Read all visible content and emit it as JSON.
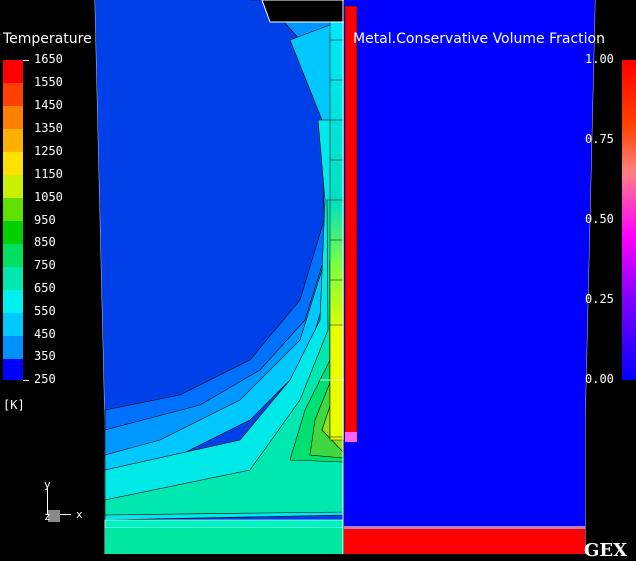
{
  "temperature_legend": {
    "title": "Temperature",
    "unit": "[K]",
    "ticks": [
      "1650",
      "1550",
      "1450",
      "1350",
      "1250",
      "1150",
      "1050",
      "950",
      "850",
      "750",
      "650",
      "550",
      "450",
      "350",
      "250"
    ],
    "colors": [
      "#ff0000",
      "#ff4000",
      "#ff8000",
      "#ffb000",
      "#ffe000",
      "#c8f000",
      "#60e000",
      "#00d000",
      "#00e060",
      "#00e8b0",
      "#00f0f0",
      "#00c8ff",
      "#0090ff",
      "#0050ff",
      "#0000ff"
    ]
  },
  "volume_fraction_legend": {
    "title": "Metal.Conservative  Volume  Fraction",
    "ticks": [
      "1.00",
      "0.75",
      "0.50",
      "0.25",
      "0.00"
    ]
  },
  "axis_triad": {
    "y": "y",
    "z": "z",
    "x": "x"
  },
  "logo": "GEX"
}
